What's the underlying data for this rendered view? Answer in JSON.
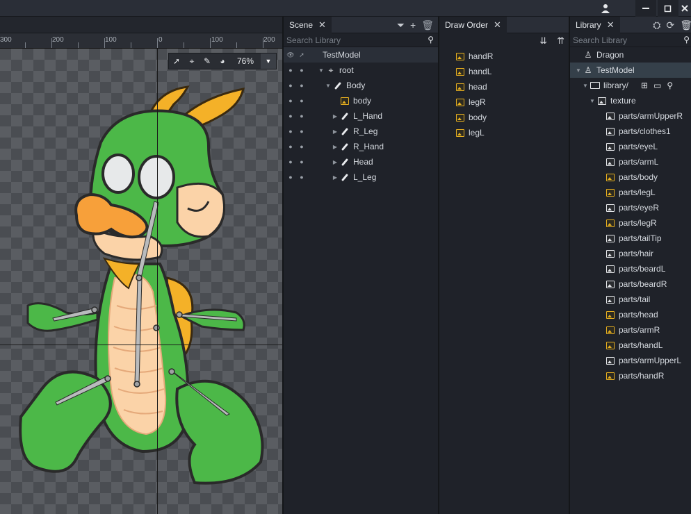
{
  "window": {
    "user_icon": "user-icon",
    "min_icon": "minimize-icon",
    "max_icon": "maximize-icon",
    "close_icon": "close-icon"
  },
  "viewport": {
    "ruler_labels": [
      "300",
      "200",
      "100",
      "0",
      "100",
      "200"
    ],
    "zoom": "76%"
  },
  "scene": {
    "tab_label": "Scene",
    "search_placeholder": "Search Library",
    "model": "TestModel",
    "tree": [
      {
        "label": "root",
        "icon": "pivot-icon",
        "depth": 0,
        "expanded": true
      },
      {
        "label": "Body",
        "icon": "bone-icon",
        "depth": 1,
        "expanded": true
      },
      {
        "label": "body",
        "icon": "image-icon",
        "depth": 2,
        "expanded": null
      },
      {
        "label": "L_Hand",
        "icon": "bone-icon",
        "depth": 2,
        "expanded": false
      },
      {
        "label": "R_Leg",
        "icon": "bone-icon",
        "depth": 2,
        "expanded": false
      },
      {
        "label": "R_Hand",
        "icon": "bone-icon",
        "depth": 2,
        "expanded": false
      },
      {
        "label": "Head",
        "icon": "bone-icon",
        "depth": 2,
        "expanded": false
      },
      {
        "label": "L_Leg",
        "icon": "bone-icon",
        "depth": 2,
        "expanded": false
      }
    ]
  },
  "draw_order": {
    "tab_label": "Draw Order",
    "items": [
      "handR",
      "handL",
      "head",
      "legR",
      "body",
      "legL"
    ]
  },
  "library": {
    "tab_label": "Library",
    "search_placeholder": "Search Library",
    "items": [
      {
        "label": "Dragon",
        "kind": "model",
        "depth": 0
      },
      {
        "label": "TestModel",
        "kind": "model",
        "depth": 0,
        "selected": true
      },
      {
        "label": "library/",
        "kind": "folder",
        "depth": 1
      },
      {
        "label": "texture",
        "kind": "atlas",
        "depth": 2
      },
      {
        "label": "parts/armUpperR",
        "kind": "image-white",
        "depth": 3
      },
      {
        "label": "parts/clothes1",
        "kind": "image-white",
        "depth": 3
      },
      {
        "label": "parts/eyeL",
        "kind": "image-white",
        "depth": 3
      },
      {
        "label": "parts/armL",
        "kind": "image-white",
        "depth": 3
      },
      {
        "label": "parts/body",
        "kind": "image",
        "depth": 3
      },
      {
        "label": "parts/legL",
        "kind": "image",
        "depth": 3
      },
      {
        "label": "parts/eyeR",
        "kind": "image-white",
        "depth": 3
      },
      {
        "label": "parts/legR",
        "kind": "image",
        "depth": 3
      },
      {
        "label": "parts/tailTip",
        "kind": "image-white",
        "depth": 3
      },
      {
        "label": "parts/hair",
        "kind": "image-white",
        "depth": 3
      },
      {
        "label": "parts/beardL",
        "kind": "image-white",
        "depth": 3
      },
      {
        "label": "parts/beardR",
        "kind": "image-white",
        "depth": 3
      },
      {
        "label": "parts/tail",
        "kind": "image-white",
        "depth": 3
      },
      {
        "label": "parts/head",
        "kind": "image",
        "depth": 3
      },
      {
        "label": "parts/armR",
        "kind": "image",
        "depth": 3
      },
      {
        "label": "parts/handL",
        "kind": "image",
        "depth": 3
      },
      {
        "label": "parts/armUpperL",
        "kind": "image-white",
        "depth": 3
      },
      {
        "label": "parts/handR",
        "kind": "image",
        "depth": 3
      }
    ]
  },
  "colors": {
    "accent_image": "#e8b020",
    "selection": "#35404a",
    "panel_bg": "#1f2229"
  }
}
